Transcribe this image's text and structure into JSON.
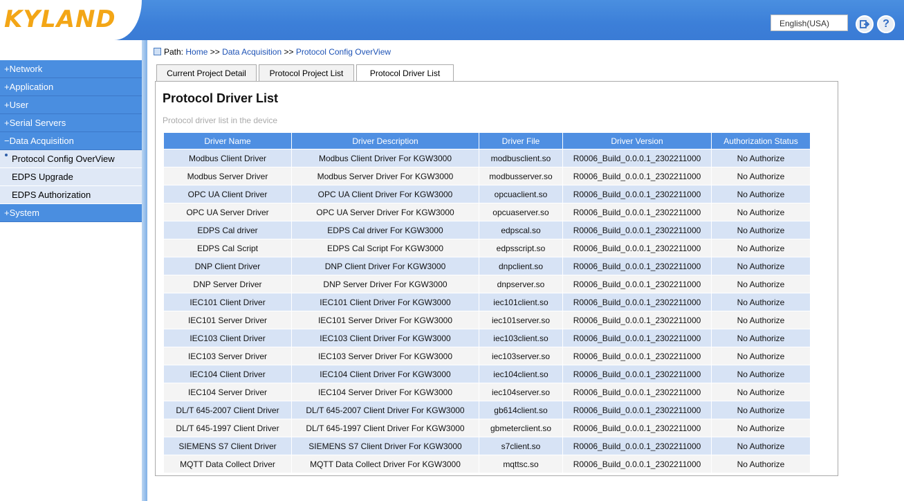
{
  "header": {
    "logo_text": "KYLAND",
    "language": "English(USA)",
    "logout_icon": "logout-icon",
    "help_icon": "help-icon",
    "accent_color": "#3c7fd8",
    "logo_color": "#f3a616"
  },
  "sidebar": {
    "items": [
      {
        "label": "+Network"
      },
      {
        "label": "+Application"
      },
      {
        "label": "+User"
      },
      {
        "label": "+Serial Servers"
      },
      {
        "label": "−Data Acquisition"
      }
    ],
    "sub_items": [
      {
        "label": "Protocol Config OverView"
      },
      {
        "label": "EDPS Upgrade"
      },
      {
        "label": "EDPS Authorization"
      }
    ],
    "system": {
      "label": "+System"
    }
  },
  "path": {
    "prefix": "Path:",
    "home": "Home",
    "sep1": ">>",
    "section": "Data Acquisition",
    "sep2": ">>",
    "page": "Protocol Config OverView"
  },
  "tabs": [
    {
      "label": "Current Project Detail"
    },
    {
      "label": "Protocol Project List"
    },
    {
      "label": "Protocol Driver List"
    }
  ],
  "panel": {
    "title": "Protocol Driver List",
    "subtitle": "Protocol driver list in the device"
  },
  "table": {
    "columns": [
      "Driver Name",
      "Driver Description",
      "Driver File",
      "Driver Version",
      "Authorization Status"
    ],
    "rows": [
      [
        "Modbus Client Driver",
        "Modbus Client Driver For KGW3000",
        "modbusclient.so",
        "R0006_Build_0.0.0.1_2302211000",
        "No Authorize"
      ],
      [
        "Modbus Server Driver",
        "Modbus Server Driver For KGW3000",
        "modbusserver.so",
        "R0006_Build_0.0.0.1_2302211000",
        "No Authorize"
      ],
      [
        "OPC UA Client Driver",
        "OPC UA Client Driver For KGW3000",
        "opcuaclient.so",
        "R0006_Build_0.0.0.1_2302211000",
        "No Authorize"
      ],
      [
        "OPC UA Server Driver",
        "OPC UA Server Driver For KGW3000",
        "opcuaserver.so",
        "R0006_Build_0.0.0.1_2302211000",
        "No Authorize"
      ],
      [
        "EDPS Cal driver",
        "EDPS Cal driver For KGW3000",
        "edpscal.so",
        "R0006_Build_0.0.0.1_2302211000",
        "No Authorize"
      ],
      [
        "EDPS Cal Script",
        "EDPS Cal Script For KGW3000",
        "edpsscript.so",
        "R0006_Build_0.0.0.1_2302211000",
        "No Authorize"
      ],
      [
        "DNP Client Driver",
        "DNP Client Driver For KGW3000",
        "dnpclient.so",
        "R0006_Build_0.0.0.1_2302211000",
        "No Authorize"
      ],
      [
        "DNP Server Driver",
        "DNP Server Driver For KGW3000",
        "dnpserver.so",
        "R0006_Build_0.0.0.1_2302211000",
        "No Authorize"
      ],
      [
        "IEC101 Client Driver",
        "IEC101 Client Driver For KGW3000",
        "iec101client.so",
        "R0006_Build_0.0.0.1_2302211000",
        "No Authorize"
      ],
      [
        "IEC101 Server Driver",
        "IEC101 Server Driver For KGW3000",
        "iec101server.so",
        "R0006_Build_0.0.0.1_2302211000",
        "No Authorize"
      ],
      [
        "IEC103 Client Driver",
        "IEC103 Client Driver For KGW3000",
        "iec103client.so",
        "R0006_Build_0.0.0.1_2302211000",
        "No Authorize"
      ],
      [
        "IEC103 Server Driver",
        "IEC103 Server Driver For KGW3000",
        "iec103server.so",
        "R0006_Build_0.0.0.1_2302211000",
        "No Authorize"
      ],
      [
        "IEC104 Client Driver",
        "IEC104 Client Driver For KGW3000",
        "iec104client.so",
        "R0006_Build_0.0.0.1_2302211000",
        "No Authorize"
      ],
      [
        "IEC104 Server Driver",
        "IEC104 Server Driver For KGW3000",
        "iec104server.so",
        "R0006_Build_0.0.0.1_2302211000",
        "No Authorize"
      ],
      [
        "DL/T 645-2007 Client Driver",
        "DL/T 645-2007 Client Driver For KGW3000",
        "gb614client.so",
        "R0006_Build_0.0.0.1_2302211000",
        "No Authorize"
      ],
      [
        "DL/T 645-1997 Client Driver",
        "DL/T 645-1997 Client Driver For KGW3000",
        "gbmeterclient.so",
        "R0006_Build_0.0.0.1_2302211000",
        "No Authorize"
      ],
      [
        "SIEMENS S7 Client Driver",
        "SIEMENS S7 Client Driver For KGW3000",
        "s7client.so",
        "R0006_Build_0.0.0.1_2302211000",
        "No Authorize"
      ],
      [
        "MQTT Data Collect Driver",
        "MQTT Data Collect Driver For KGW3000",
        "mqttsc.so",
        "R0006_Build_0.0.0.1_2302211000",
        "No Authorize"
      ]
    ]
  }
}
